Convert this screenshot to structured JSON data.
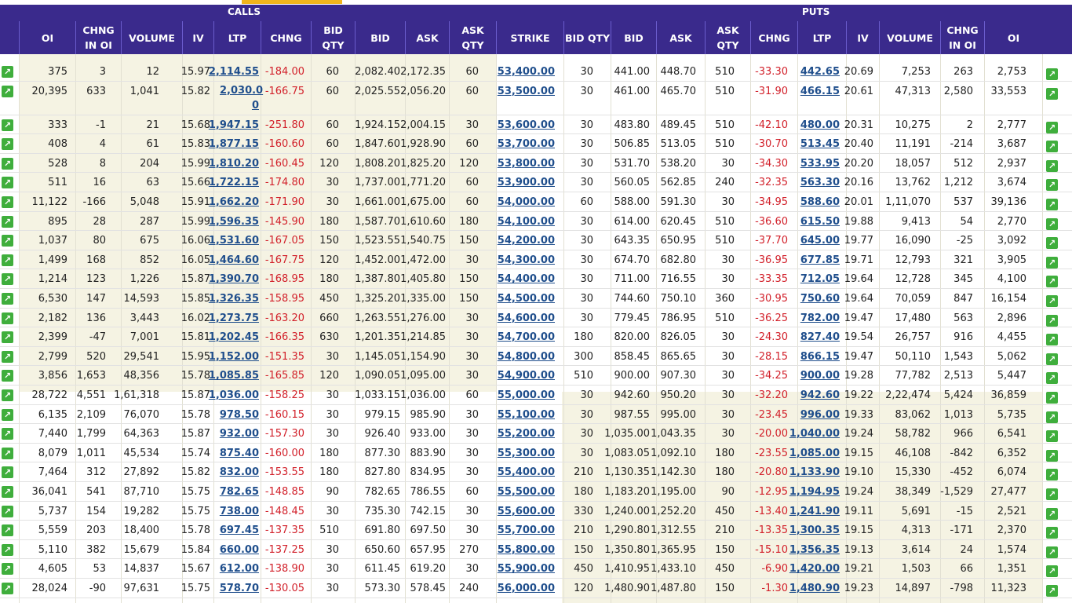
{
  "header": {
    "calls_label": "CALLS",
    "puts_label": "PUTS"
  },
  "columns": {
    "call": [
      "OI",
      "CHNG IN OI",
      "VOLUME",
      "IV",
      "LTP",
      "CHNG",
      "BID QTY",
      "BID",
      "ASK",
      "ASK QTY"
    ],
    "strike": "STRIKE",
    "put": [
      "BID QTY",
      "BID",
      "ASK",
      "ASK QTY",
      "CHNG",
      "LTP",
      "IV",
      "VOLUME",
      "CHNG IN OI",
      "OI"
    ]
  },
  "icons": {
    "chart": "chart-trend-icon"
  },
  "colors": {
    "header_bg": "#3a2a8c",
    "itm_bg": "#f5f3e3",
    "negative": "#d2202a",
    "link": "#1f4e8c",
    "icon_green": "#3fae3c",
    "accent": "#f1b51c"
  },
  "rows": [
    {
      "c": [
        "375",
        "3",
        "12",
        "15.97",
        "2,114.55",
        "-184.00",
        "60",
        "2,082.40",
        "2,172.35",
        "60"
      ],
      "strike": "53,400.00",
      "p": [
        "30",
        "441.00",
        "448.70",
        "510",
        "-33.30",
        "442.65",
        "20.69",
        "7,253",
        "263",
        "2,753"
      ]
    },
    {
      "c": [
        "20,395",
        "633",
        "1,041",
        "15.82",
        "2,030.0 0",
        "-166.75",
        "60",
        "2,025.55",
        "2,056.20",
        "60"
      ],
      "strike": "53,500.00",
      "p": [
        "30",
        "461.00",
        "465.70",
        "510",
        "-31.90",
        "466.15",
        "20.61",
        "47,313",
        "2,580",
        "33,553"
      ]
    },
    {
      "c": [
        "333",
        "-1",
        "21",
        "15.68",
        "1,947.15",
        "-251.80",
        "60",
        "1,924.15",
        "2,004.15",
        "30"
      ],
      "strike": "53,600.00",
      "p": [
        "30",
        "483.80",
        "489.45",
        "510",
        "-42.10",
        "480.00",
        "20.31",
        "10,275",
        "2",
        "2,777"
      ]
    },
    {
      "c": [
        "408",
        "4",
        "61",
        "15.83",
        "1,877.15",
        "-160.60",
        "60",
        "1,847.60",
        "1,928.90",
        "60"
      ],
      "strike": "53,700.00",
      "p": [
        "30",
        "506.85",
        "513.05",
        "510",
        "-30.70",
        "513.45",
        "20.40",
        "11,191",
        "-214",
        "3,687"
      ]
    },
    {
      "c": [
        "528",
        "8",
        "204",
        "15.99",
        "1,810.20",
        "-160.45",
        "120",
        "1,808.20",
        "1,825.20",
        "120"
      ],
      "strike": "53,800.00",
      "p": [
        "30",
        "531.70",
        "538.20",
        "30",
        "-34.30",
        "533.95",
        "20.20",
        "18,057",
        "512",
        "2,937"
      ]
    },
    {
      "c": [
        "511",
        "16",
        "63",
        "15.66",
        "1,722.15",
        "-174.80",
        "30",
        "1,737.00",
        "1,771.20",
        "60"
      ],
      "strike": "53,900.00",
      "p": [
        "30",
        "560.05",
        "562.85",
        "240",
        "-32.35",
        "563.30",
        "20.16",
        "13,762",
        "1,212",
        "3,674"
      ]
    },
    {
      "c": [
        "11,122",
        "-166",
        "5,048",
        "15.91",
        "1,662.20",
        "-171.90",
        "30",
        "1,661.00",
        "1,675.00",
        "60"
      ],
      "strike": "54,000.00",
      "p": [
        "60",
        "588.00",
        "591.30",
        "30",
        "-34.95",
        "588.60",
        "20.01",
        "1,11,070",
        "537",
        "39,136"
      ]
    },
    {
      "c": [
        "895",
        "28",
        "287",
        "15.99",
        "1,596.35",
        "-145.90",
        "180",
        "1,587.70",
        "1,610.60",
        "180"
      ],
      "strike": "54,100.00",
      "p": [
        "30",
        "614.00",
        "620.45",
        "510",
        "-36.60",
        "615.50",
        "19.88",
        "9,413",
        "54",
        "2,770"
      ]
    },
    {
      "c": [
        "1,037",
        "80",
        "675",
        "16.06",
        "1,531.60",
        "-167.05",
        "150",
        "1,523.55",
        "1,540.75",
        "150"
      ],
      "strike": "54,200.00",
      "p": [
        "30",
        "643.35",
        "650.95",
        "510",
        "-37.70",
        "645.00",
        "19.77",
        "16,090",
        "-25",
        "3,092"
      ]
    },
    {
      "c": [
        "1,499",
        "168",
        "852",
        "16.05",
        "1,464.60",
        "-167.75",
        "120",
        "1,452.00",
        "1,472.00",
        "30"
      ],
      "strike": "54,300.00",
      "p": [
        "30",
        "674.70",
        "682.80",
        "30",
        "-36.95",
        "677.85",
        "19.71",
        "12,793",
        "321",
        "3,905"
      ]
    },
    {
      "c": [
        "1,214",
        "123",
        "1,226",
        "15.87",
        "1,390.70",
        "-168.95",
        "180",
        "1,387.80",
        "1,405.80",
        "150"
      ],
      "strike": "54,400.00",
      "p": [
        "30",
        "711.00",
        "716.55",
        "30",
        "-33.35",
        "712.05",
        "19.64",
        "12,728",
        "345",
        "4,100"
      ]
    },
    {
      "c": [
        "6,530",
        "147",
        "14,593",
        "15.85",
        "1,326.35",
        "-158.95",
        "450",
        "1,325.20",
        "1,335.00",
        "150"
      ],
      "strike": "54,500.00",
      "p": [
        "30",
        "744.60",
        "750.10",
        "360",
        "-30.95",
        "750.60",
        "19.64",
        "70,059",
        "847",
        "16,154"
      ]
    },
    {
      "c": [
        "2,182",
        "136",
        "3,443",
        "16.02",
        "1,273.75",
        "-163.20",
        "660",
        "1,263.55",
        "1,276.00",
        "30"
      ],
      "strike": "54,600.00",
      "p": [
        "30",
        "779.45",
        "786.95",
        "510",
        "-36.25",
        "782.00",
        "19.47",
        "17,480",
        "563",
        "2,896"
      ]
    },
    {
      "c": [
        "2,399",
        "-47",
        "7,001",
        "15.81",
        "1,202.45",
        "-166.35",
        "630",
        "1,201.35",
        "1,214.85",
        "30"
      ],
      "strike": "54,700.00",
      "p": [
        "180",
        "820.00",
        "826.05",
        "30",
        "-24.30",
        "827.40",
        "19.54",
        "26,757",
        "916",
        "4,455"
      ]
    },
    {
      "c": [
        "2,799",
        "520",
        "29,541",
        "15.95",
        "1,152.00",
        "-151.35",
        "30",
        "1,145.05",
        "1,154.90",
        "30"
      ],
      "strike": "54,800.00",
      "p": [
        "300",
        "858.45",
        "865.65",
        "30",
        "-28.15",
        "866.15",
        "19.47",
        "50,110",
        "1,543",
        "5,062"
      ]
    },
    {
      "c": [
        "3,856",
        "1,653",
        "48,356",
        "15.78",
        "1,085.85",
        "-165.85",
        "120",
        "1,090.05",
        "1,095.00",
        "30"
      ],
      "strike": "54,900.00",
      "p": [
        "510",
        "900.00",
        "907.30",
        "30",
        "-34.25",
        "900.00",
        "19.28",
        "77,782",
        "2,513",
        "5,447"
      ]
    },
    {
      "c": [
        "28,722",
        "4,551",
        "1,61,318",
        "15.87",
        "1,036.00",
        "-158.25",
        "30",
        "1,033.15",
        "1,036.00",
        "60"
      ],
      "strike": "55,000.00",
      "p": [
        "30",
        "942.60",
        "950.20",
        "30",
        "-32.20",
        "942.60",
        "19.22",
        "2,22,474",
        "5,424",
        "36,859"
      ]
    },
    {
      "c": [
        "6,135",
        "2,109",
        "76,070",
        "15.78",
        "978.50",
        "-160.15",
        "30",
        "979.15",
        "985.90",
        "30"
      ],
      "strike": "55,100.00",
      "p": [
        "30",
        "987.55",
        "995.00",
        "30",
        "-23.45",
        "996.00",
        "19.33",
        "83,062",
        "1,013",
        "5,735"
      ]
    },
    {
      "c": [
        "7,440",
        "1,799",
        "64,363",
        "15.87",
        "932.00",
        "-157.30",
        "30",
        "926.40",
        "933.00",
        "30"
      ],
      "strike": "55,200.00",
      "p": [
        "30",
        "1,035.00",
        "1,043.35",
        "30",
        "-20.00",
        "1,040.00",
        "19.24",
        "58,782",
        "966",
        "6,541"
      ]
    },
    {
      "c": [
        "8,079",
        "1,011",
        "45,534",
        "15.74",
        "875.40",
        "-160.00",
        "180",
        "877.30",
        "883.90",
        "30"
      ],
      "strike": "55,300.00",
      "p": [
        "30",
        "1,083.05",
        "1,092.10",
        "180",
        "-23.55",
        "1,085.00",
        "19.15",
        "46,108",
        "-842",
        "6,352"
      ]
    },
    {
      "c": [
        "7,464",
        "312",
        "27,892",
        "15.82",
        "832.00",
        "-153.55",
        "180",
        "827.80",
        "834.95",
        "30"
      ],
      "strike": "55,400.00",
      "p": [
        "210",
        "1,130.35",
        "1,142.30",
        "180",
        "-20.80",
        "1,133.90",
        "19.10",
        "15,330",
        "-452",
        "6,074"
      ]
    },
    {
      "c": [
        "36,041",
        "541",
        "87,710",
        "15.75",
        "782.65",
        "-148.85",
        "90",
        "782.65",
        "786.55",
        "60"
      ],
      "strike": "55,500.00",
      "p": [
        "180",
        "1,183.20",
        "1,195.00",
        "90",
        "-12.95",
        "1,194.95",
        "19.24",
        "38,349",
        "-1,529",
        "27,477"
      ]
    },
    {
      "c": [
        "5,737",
        "154",
        "19,282",
        "15.75",
        "738.00",
        "-148.45",
        "30",
        "735.30",
        "742.15",
        "30"
      ],
      "strike": "55,600.00",
      "p": [
        "330",
        "1,240.00",
        "1,252.20",
        "450",
        "-13.40",
        "1,241.90",
        "19.11",
        "5,691",
        "-15",
        "2,521"
      ]
    },
    {
      "c": [
        "5,559",
        "203",
        "18,400",
        "15.78",
        "697.45",
        "-137.35",
        "510",
        "691.80",
        "697.50",
        "30"
      ],
      "strike": "55,700.00",
      "p": [
        "210",
        "1,290.80",
        "1,312.55",
        "210",
        "-13.35",
        "1,300.35",
        "19.15",
        "4,313",
        "-171",
        "2,370"
      ]
    },
    {
      "c": [
        "5,110",
        "382",
        "15,679",
        "15.84",
        "660.00",
        "-137.25",
        "30",
        "650.60",
        "657.95",
        "270"
      ],
      "strike": "55,800.00",
      "p": [
        "150",
        "1,350.80",
        "1,365.95",
        "150",
        "-15.10",
        "1,356.35",
        "19.13",
        "3,614",
        "24",
        "1,574"
      ]
    },
    {
      "c": [
        "4,605",
        "53",
        "14,837",
        "15.67",
        "612.00",
        "-138.90",
        "30",
        "611.45",
        "619.20",
        "30"
      ],
      "strike": "55,900.00",
      "p": [
        "450",
        "1,410.95",
        "1,433.10",
        "450",
        "-6.90",
        "1,420.00",
        "19.21",
        "1,503",
        "66",
        "1,351"
      ]
    },
    {
      "c": [
        "28,024",
        "-90",
        "97,631",
        "15.75",
        "578.70",
        "-130.05",
        "30",
        "573.30",
        "578.45",
        "240"
      ],
      "strike": "56,000.00",
      "p": [
        "120",
        "1,480.90",
        "1,487.80",
        "150",
        "-1.30",
        "1,480.90",
        "19.23",
        "14,897",
        "-798",
        "11,323"
      ]
    }
  ]
}
